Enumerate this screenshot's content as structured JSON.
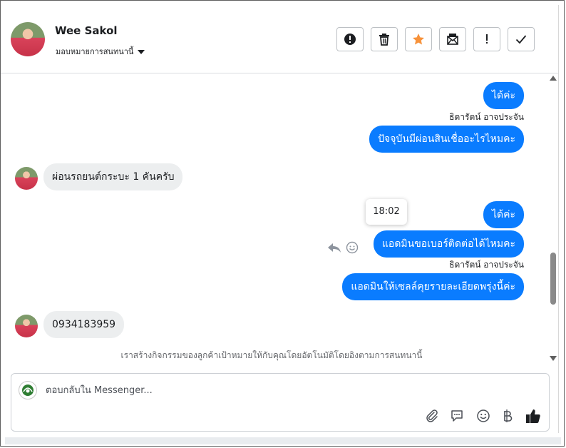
{
  "header": {
    "contact_name": "Wee Sakol",
    "assign_label": "มอบหมายการสนทนานี้",
    "actions": [
      {
        "name": "spam",
        "icon": "exclamation-circle-icon"
      },
      {
        "name": "delete",
        "icon": "trash-icon"
      },
      {
        "name": "star",
        "icon": "star-icon",
        "color": "#f7923a"
      },
      {
        "name": "mark-unread",
        "icon": "envelope-icon"
      },
      {
        "name": "follow-up",
        "icon": "exclamation-icon"
      },
      {
        "name": "done",
        "icon": "check-icon"
      }
    ]
  },
  "messages": [
    {
      "side": "out",
      "text": "ได้ค่ะ"
    },
    {
      "sender": "ธิดารัตน์ อาจประจัน"
    },
    {
      "side": "out",
      "text": "ปัจจุบันมีผ่อนสินเชื่ออะไรไหมคะ"
    },
    {
      "side": "in",
      "text": "ผ่อนรถยนต์กระบะ 1 คันครับ"
    },
    {
      "side": "out",
      "text": "ได้ค่ะ"
    },
    {
      "side": "out",
      "text": "แอดมินขอเบอร์ติดต่อได้ไหมคะ"
    },
    {
      "sender": "ธิดารัตน์ อาจประจัน"
    },
    {
      "side": "out",
      "text": "แอดมินให้เซลล์คุยรายละเอียดพรุ่งนี้ค่ะ"
    },
    {
      "side": "in",
      "text": "0934183959"
    }
  ],
  "tooltip_time": "18:02",
  "system_note": "เราสร้างกิจกรรมของลูกค้าเป้าหมายให้กับคุณโดยอัตโนมัติโดยอิงตามการสนทนานี้",
  "composer": {
    "placeholder": "ตอบกลับใน Messenger...",
    "icons": [
      "paperclip-icon",
      "saved-reply-icon",
      "emoji-icon",
      "baht-payment-icon",
      "like-icon"
    ]
  },
  "colors": {
    "outgoing_bubble": "#0a7cff",
    "incoming_bubble": "#eceeef",
    "star_accent": "#f7923a"
  }
}
